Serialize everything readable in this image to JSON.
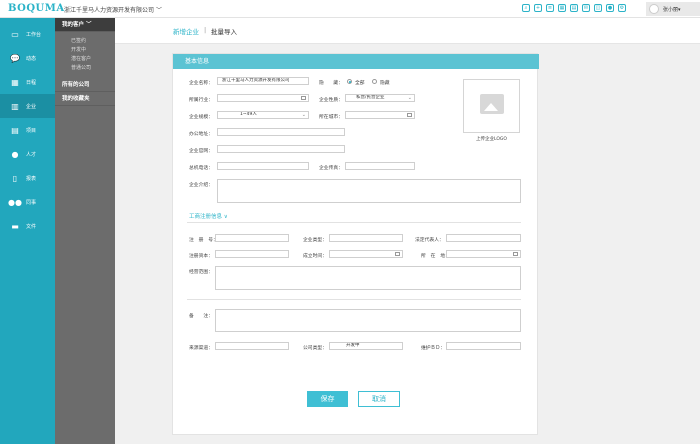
{
  "brand": {
    "logo": "BOQUMA",
    "company": "浙江千里马人力资源开发有限公司",
    "company_arrow": "﹀",
    "accent": "#2bb3c8"
  },
  "topbar": {
    "icons": [
      "search-icon",
      "add-icon",
      "doc-icon",
      "calendar-icon",
      "chart-icon",
      "message-icon",
      "mail-icon",
      "location-icon",
      "settings-icon"
    ],
    "username": "张小丽",
    "user_arrow": "▾"
  },
  "sidebar": {
    "items": [
      {
        "label": "工作台",
        "icon": "monitor-icon"
      },
      {
        "label": "动态",
        "icon": "chat-icon"
      },
      {
        "label": "日程",
        "icon": "calendar-icon"
      },
      {
        "label": "企业",
        "icon": "building-icon"
      },
      {
        "label": "项目",
        "icon": "project-icon"
      },
      {
        "label": "人才",
        "icon": "person-icon"
      },
      {
        "label": "报表",
        "icon": "report-icon"
      },
      {
        "label": "同事",
        "icon": "colleagues-icon"
      },
      {
        "label": "文件",
        "icon": "folder-icon"
      }
    ]
  },
  "subnav": {
    "my_clients": "我的客户",
    "my_clients_arrow": "﹀",
    "items": [
      "已签约",
      "开发中",
      "潜在客户",
      "普通公司"
    ],
    "all_companies": "所有的公司",
    "favorites": "我的收藏夹"
  },
  "breadcrumb": {
    "first": "新增企业",
    "sep": "|",
    "second": "批量导入"
  },
  "form": {
    "panel_title": "基本信息",
    "company_name_label": "企业名称：",
    "company_name_value": "浙江千里马人力资源开发有限公司",
    "hidden_label": "隐　　藏：",
    "hidden_all": "全部",
    "hidden_none": "隐藏",
    "industry_label": "所属行业：",
    "nature_label": "企业性质：",
    "nature_value": "私营/民营企业",
    "scale_label": "企业规模：",
    "scale_value": "1~49人",
    "city_label": "所在城市：",
    "address_label": "办公地址：",
    "website_label": "企业官网：",
    "phone_label": "总机电话：",
    "fax_label": "企业传真：",
    "intro_label": "企业介绍：",
    "logo_caption": "上传企业LOGO",
    "reg_section": "工商注册信息",
    "reg_toggle": "∨",
    "reg_no_label": "注　册　号：",
    "type_label": "企业类型：",
    "legal_label": "法定代表人：",
    "capital_label": "注册资本：",
    "founded_label": "成立时间：",
    "location_label": "所　在　地：",
    "scope_label": "经营范围：",
    "remark_label": "备　　注：",
    "source_label": "来源渠道：",
    "company_type_label": "公司类型：",
    "company_type_value": "开发中",
    "maintainer_label": "维护ＢＤ："
  },
  "buttons": {
    "save": "保存",
    "cancel": "取消"
  }
}
